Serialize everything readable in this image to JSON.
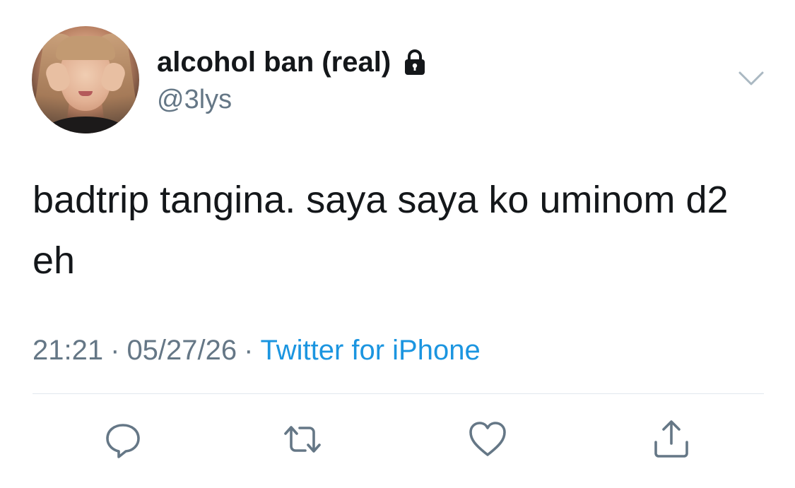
{
  "tweet": {
    "display_name": "alcohol ban (real)",
    "handle": "@3lys",
    "text": "badtrip tangina. saya saya ko uminom d2 eh",
    "time": "21:21",
    "date": "05/27/26",
    "separator": "·",
    "source": "Twitter for iPhone",
    "protected_icon": "lock-icon",
    "menu_icon": "chevron-down-icon"
  },
  "actions": [
    {
      "name": "reply",
      "icon": "reply-icon"
    },
    {
      "name": "retweet",
      "icon": "retweet-icon"
    },
    {
      "name": "like",
      "icon": "heart-icon"
    },
    {
      "name": "share",
      "icon": "share-icon"
    }
  ],
  "colors": {
    "text": "#14171a",
    "secondary": "#657786",
    "link": "#1b95e0",
    "divider": "#e1e8ed"
  }
}
